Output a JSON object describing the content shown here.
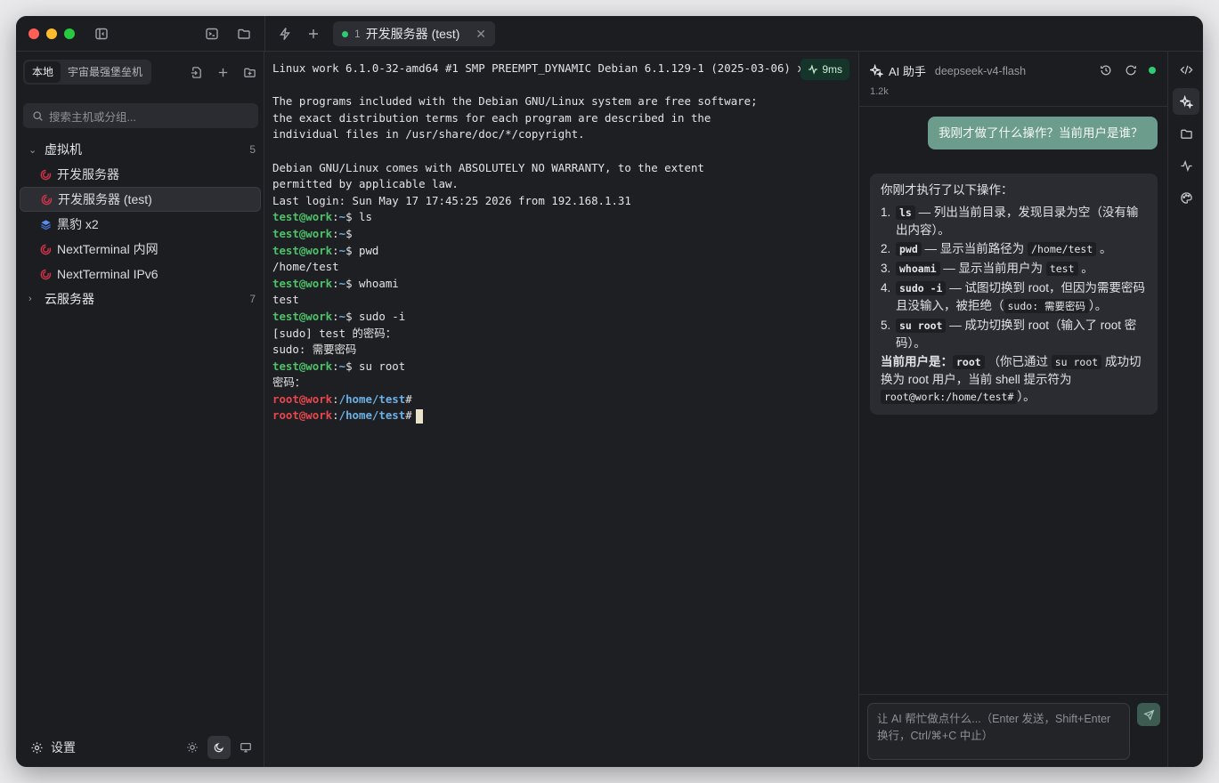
{
  "tab": {
    "index": "1",
    "title": "开发服务器 (test)",
    "close": "✕"
  },
  "sidebar": {
    "segments": [
      "本地",
      "宇宙最强堡垒机"
    ],
    "search_placeholder": "搜索主机或分组...",
    "groups": [
      {
        "name": "虚拟机",
        "count": "5",
        "expanded": true,
        "hosts": [
          {
            "name": "开发服务器",
            "icon": "debian-icon"
          },
          {
            "name": "开发服务器 (test)",
            "icon": "debian-icon",
            "active": true
          },
          {
            "name": "黑豹 x2",
            "icon": "stack-icon"
          },
          {
            "name": "NextTerminal 内网",
            "icon": "debian-icon"
          },
          {
            "name": "NextTerminal IPv6",
            "icon": "debian-icon"
          }
        ]
      },
      {
        "name": "云服务器",
        "count": "7",
        "expanded": false
      }
    ],
    "settings_label": "设置"
  },
  "terminal": {
    "latency": "9ms",
    "lines": [
      [
        [
          "Linux work 6.1.0-32-amd64 #1 SMP PREEMPT_DYNAMIC Debian 6.1.129-1 (2025-03-06) x86_64",
          ""
        ]
      ],
      [
        [
          "",
          ""
        ]
      ],
      [
        [
          "The programs included with the Debian GNU/Linux system are free software;",
          ""
        ]
      ],
      [
        [
          "the exact distribution terms for each program are described in the",
          ""
        ]
      ],
      [
        [
          "individual files in /usr/share/doc/*/copyright.",
          ""
        ]
      ],
      [
        [
          "",
          ""
        ]
      ],
      [
        [
          "Debian GNU/Linux comes with ABSOLUTELY NO WARRANTY, to the extent",
          ""
        ]
      ],
      [
        [
          "permitted by applicable law.",
          ""
        ]
      ],
      [
        [
          "Last login: Sun May 17 17:45:25 2026 from 192.168.1.31",
          ""
        ]
      ],
      [
        [
          "test@work",
          "green"
        ],
        [
          ":",
          ""
        ],
        [
          "~",
          "blue"
        ],
        [
          "$ ls",
          ""
        ]
      ],
      [
        [
          "test@work",
          "green"
        ],
        [
          ":",
          ""
        ],
        [
          "~",
          "blue"
        ],
        [
          "$",
          ""
        ]
      ],
      [
        [
          "test@work",
          "green"
        ],
        [
          ":",
          ""
        ],
        [
          "~",
          "blue"
        ],
        [
          "$ pwd",
          ""
        ]
      ],
      [
        [
          "/home/test",
          ""
        ]
      ],
      [
        [
          "test@work",
          "green"
        ],
        [
          ":",
          ""
        ],
        [
          "~",
          "blue"
        ],
        [
          "$ whoami",
          ""
        ]
      ],
      [
        [
          "test",
          ""
        ]
      ],
      [
        [
          "test@work",
          "green"
        ],
        [
          ":",
          ""
        ],
        [
          "~",
          "blue"
        ],
        [
          "$ sudo -i",
          ""
        ]
      ],
      [
        [
          "[sudo] test 的密码：",
          ""
        ]
      ],
      [
        [
          "sudo: 需要密码",
          ""
        ]
      ],
      [
        [
          "test@work",
          "green"
        ],
        [
          ":",
          ""
        ],
        [
          "~",
          "blue"
        ],
        [
          "$ su root",
          ""
        ]
      ],
      [
        [
          "密码：",
          ""
        ]
      ],
      [
        [
          "root@work",
          "red"
        ],
        [
          ":",
          ""
        ],
        [
          "/home/test",
          "blue"
        ],
        [
          "#",
          ""
        ]
      ],
      [
        [
          "root@work",
          "red"
        ],
        [
          ":",
          ""
        ],
        [
          "/home/test",
          "blue"
        ],
        [
          "#",
          ""
        ],
        [
          "",
          "cursor"
        ]
      ]
    ]
  },
  "ai": {
    "title": "AI 助手",
    "model": "deepseek-v4-flash",
    "tokens": "1.2k",
    "user_message": "我刚才做了什么操作？当前用户是谁？",
    "reply": {
      "intro": "你刚才执行了以下操作：",
      "items": [
        {
          "num": "1.",
          "parts": [
            [
              "ls",
              "codeb"
            ],
            [
              " — 列出当前目录，发现目录为空（没有输出内容）。",
              ""
            ]
          ]
        },
        {
          "num": "2.",
          "parts": [
            [
              "pwd",
              "codeb"
            ],
            [
              " — 显示当前路径为 ",
              ""
            ],
            [
              "/home/test",
              "code"
            ],
            [
              " 。",
              ""
            ]
          ]
        },
        {
          "num": "3.",
          "parts": [
            [
              "whoami",
              "codeb"
            ],
            [
              " — 显示当前用户为 ",
              ""
            ],
            [
              "test",
              "code"
            ],
            [
              " 。",
              ""
            ]
          ]
        },
        {
          "num": "4.",
          "parts": [
            [
              "sudo -i",
              "codeb"
            ],
            [
              " — 试图切换到 root，但因为需要密码且没输入，被拒绝（",
              ""
            ],
            [
              "sudo: 需要密码",
              "code"
            ],
            [
              "）。",
              ""
            ]
          ]
        },
        {
          "num": "5.",
          "parts": [
            [
              "su root",
              "codeb"
            ],
            [
              " — 成功切换到 root（输入了 root 密码）。",
              ""
            ]
          ]
        }
      ],
      "summary": [
        [
          "当前用户是：",
          "bold"
        ],
        [
          "root",
          "codeb"
        ],
        [
          " （你已通过 ",
          ""
        ],
        [
          "su root",
          "code"
        ],
        [
          " 成功切换为 root 用户，当前 shell 提示符为 ",
          ""
        ],
        [
          "root@work:/home/test#",
          "code"
        ],
        [
          "）。",
          ""
        ]
      ]
    },
    "input_placeholder": "让 AI 帮忙做点什么...（Enter 发送，Shift+Enter 换行，Ctrl/⌘+C 中止）"
  },
  "colors": {
    "accent": "#6c9c8c",
    "online": "#2ecc71",
    "prompt_user": "#4ec26a",
    "prompt_root": "#e8474d",
    "path": "#6cb2e6"
  }
}
